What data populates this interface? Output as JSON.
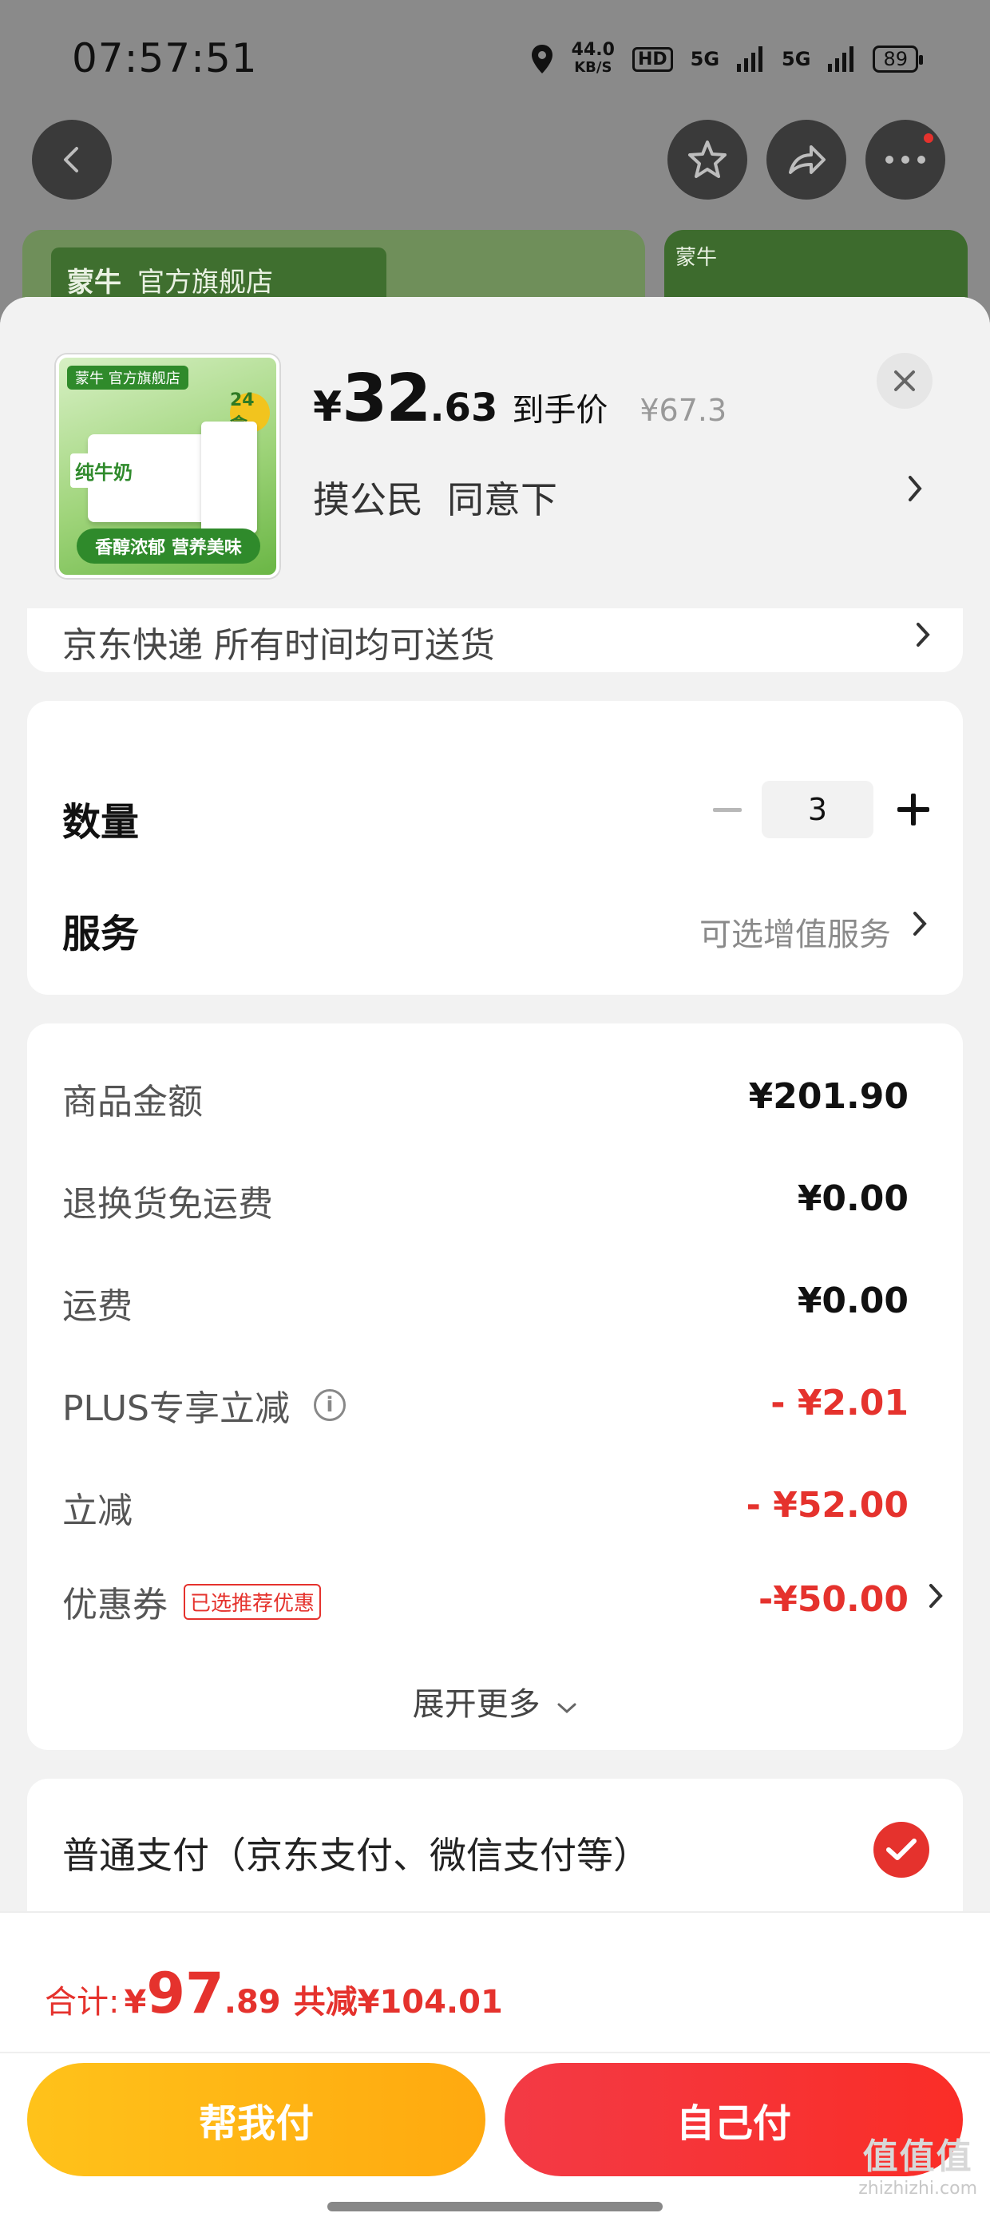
{
  "status": {
    "time": "07:57:51",
    "net_speed_value": "44.0",
    "net_speed_unit": "KB/S",
    "hd": "HD",
    "sig1": "5G",
    "sig2": "5G",
    "battery": "89"
  },
  "background": {
    "banner_left_logo": "蒙牛",
    "banner_left_text": "官方旗舰店",
    "banner_right_logo": "蒙牛"
  },
  "product": {
    "thumb_top": "蒙牛 官方旗舰店",
    "thumb_badge": "24盒",
    "thumb_milk": "纯牛奶",
    "thumb_bottom": "香醇浓郁 营养美味",
    "price_symbol": "¥",
    "price_int": "32",
    "price_dec": ".63",
    "price_label": "到手价",
    "price_orig": "¥67.3",
    "recipient_name": "摸公民",
    "recipient_status": "同意下"
  },
  "address_partial": "京东快递 所有时间均可送货",
  "quantity": {
    "label": "数量",
    "value": "3"
  },
  "service": {
    "label": "服务",
    "value": "可选增值服务"
  },
  "fees": [
    {
      "label": "商品金额",
      "value": "¥201.90",
      "red": false
    },
    {
      "label": "退换货免运费",
      "value": "¥0.00",
      "red": false
    },
    {
      "label": "运费",
      "value": "¥0.00",
      "red": false
    },
    {
      "label": "PLUS专享立减",
      "value": "- ¥2.01",
      "red": true
    },
    {
      "label": "立减",
      "value": "- ¥52.00",
      "red": true
    },
    {
      "label": "优惠券",
      "tag": "已选推荐优惠",
      "value": "-¥50.00",
      "red": true
    }
  ],
  "expand_more": "展开更多",
  "payment": {
    "label": "普通支付（京东支付、微信支付等）"
  },
  "footer": {
    "total_label": "合计:",
    "total_sym": "¥",
    "total_int": "97",
    "total_dec": ".89",
    "total_saved": "共减¥104.01",
    "btn_help": "帮我付",
    "btn_self": "自己付"
  },
  "watermark": {
    "big": "值值值",
    "small": "zhizhizhi.com"
  },
  "colors": {
    "accent_red": "#e5322d",
    "help_yellow": "#ffb516",
    "sheet_bg": "#f2f2f2"
  }
}
